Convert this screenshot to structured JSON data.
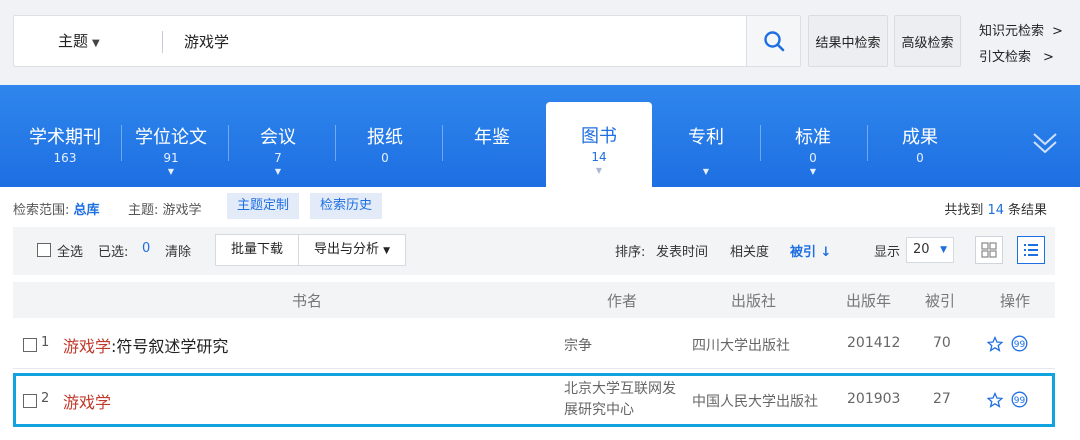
{
  "search": {
    "field": "主题",
    "query": "游戏学",
    "within_results": "结果中检索",
    "advanced": "高级检索",
    "knowledge_search": "知识元检索",
    "citation_search": "引文检索",
    "arrow": ">"
  },
  "tabs": [
    {
      "label": "学术期刊",
      "count": "163"
    },
    {
      "label": "学位论文",
      "count": "91"
    },
    {
      "label": "会议",
      "count": "7"
    },
    {
      "label": "报纸",
      "count": "0"
    },
    {
      "label": "年鉴",
      "count": ""
    },
    {
      "label": "图书",
      "count": "14"
    },
    {
      "label": "专利",
      "count": ""
    },
    {
      "label": "标准",
      "count": "0"
    },
    {
      "label": "成果",
      "count": "0"
    }
  ],
  "scope": {
    "label": "检索范围:",
    "value": "总库",
    "topic": "主题: 游戏学",
    "custom_topic": "主题定制",
    "history": "检索历史",
    "found_prefix": "共找到",
    "found_count": "14",
    "found_suffix": "条结果"
  },
  "toolbar": {
    "select_all": "全选",
    "selected_label": "已选:",
    "selected_count": "0",
    "clear": "清除",
    "batch_download": "批量下载",
    "export": "导出与分析",
    "sort_label": "排序:",
    "sort_date": "发表时间",
    "sort_relevance": "相关度",
    "sort_cited": "被引",
    "show_label": "显示",
    "page_size": "20"
  },
  "table": {
    "headers": {
      "title": "书名",
      "author": "作者",
      "publisher": "出版社",
      "year": "出版年",
      "cited": "被引",
      "ops": "操作"
    },
    "rows": [
      {
        "idx": "1",
        "title_hl": "游戏学",
        "title_rest": ":符号叙述学研究",
        "author": "宗争",
        "author2": "",
        "publisher": "四川大学出版社",
        "year": "201412",
        "cited": "70"
      },
      {
        "idx": "2",
        "title_hl": "游戏学",
        "title_rest": "",
        "author": "北京大学互联网发",
        "author2": "展研究中心",
        "publisher": "中国人民大学出版社",
        "year": "201903",
        "cited": "27"
      }
    ]
  },
  "colors": {
    "accent": "#1e6fe2",
    "highlight": "#c0392b",
    "selection_border": "#11a3e0"
  }
}
